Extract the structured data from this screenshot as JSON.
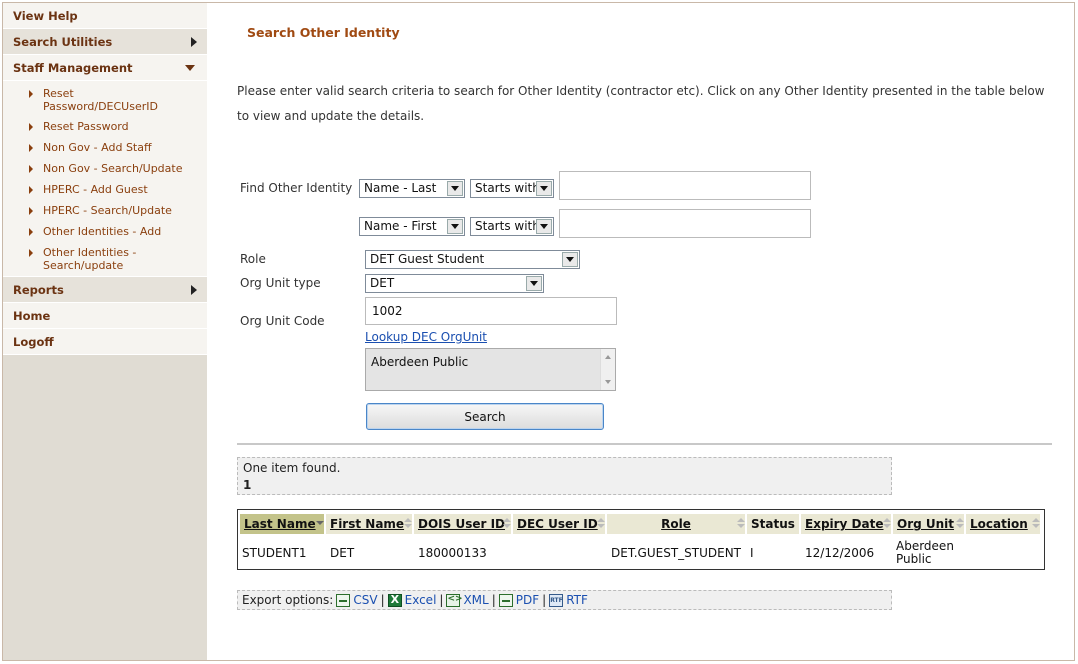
{
  "sidebar": {
    "view_help": "View Help",
    "search_utilities": "Search Utilities",
    "staff_management": "Staff Management",
    "staff_items": [
      {
        "line1": "Reset",
        "line2": "Password/DECUserID"
      },
      {
        "line1": "Reset Password",
        "line2": ""
      },
      {
        "line1": "Non Gov - Add Staff",
        "line2": ""
      },
      {
        "line1": "Non Gov - Search/Update",
        "line2": ""
      },
      {
        "line1": "HPERC - Add Guest",
        "line2": ""
      },
      {
        "line1": "HPERC - Search/Update",
        "line2": ""
      },
      {
        "line1": "Other Identities - Add",
        "line2": ""
      },
      {
        "line1": "Other Identities -",
        "line2": "Search/update"
      }
    ],
    "reports": "Reports",
    "home": "Home",
    "logoff": "Logoff"
  },
  "main": {
    "title": "Search Other Identity",
    "intro": "Please enter valid search criteria to search for Other Identity (contractor etc). Click on any Other Identity presented in the table below to view and update the details."
  },
  "form": {
    "find_label": "Find Other Identity",
    "field1": "Name - Last",
    "match1": "Starts with",
    "value1": "",
    "field2": "Name - First",
    "match2": "Starts with",
    "value2": "",
    "role_label": "Role",
    "role_value": "DET Guest Student",
    "org_type_label": "Org Unit type",
    "org_type_value": "DET",
    "org_code_label": "Org Unit Code",
    "org_code_value": "1002",
    "lookup_link": "Lookup DEC OrgUnit",
    "org_name": "Aberdeen Public",
    "search_button": "Search"
  },
  "results": {
    "summary": "One item found.",
    "page": "1",
    "columns": [
      "Last Name",
      "First Name",
      "DOIS User ID",
      "DEC User ID",
      "Role",
      "Status",
      "Expiry Date",
      "Org Unit",
      "Location"
    ],
    "rows": [
      {
        "last_name": "STUDENT1",
        "first_name": "DET",
        "dois_user_id": "180000133",
        "dec_user_id": "",
        "role": "DET.GUEST_STUDENT",
        "status": "I",
        "expiry_date": "12/12/2006",
        "org_unit_line1": "Aberdeen",
        "org_unit_line2": "Public",
        "location": ""
      }
    ]
  },
  "export": {
    "label": "Export options:",
    "options": [
      "CSV",
      "Excel",
      "XML",
      "PDF",
      "RTF"
    ],
    "separator": "|"
  }
}
